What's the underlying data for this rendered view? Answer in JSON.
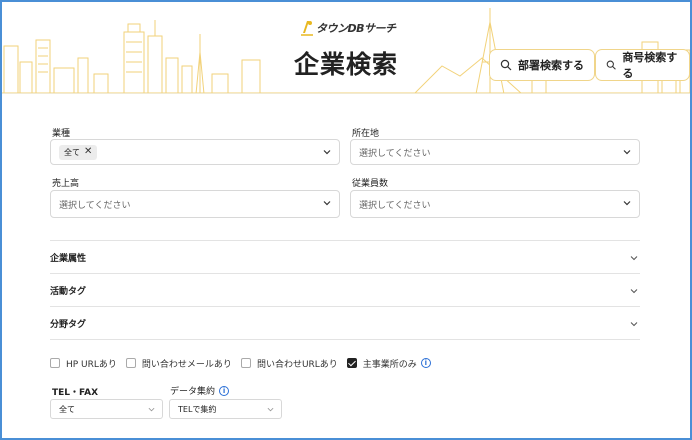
{
  "header": {
    "logo_text": "タウンDBサーチ",
    "title": "企業検索",
    "buttons": [
      {
        "label": "部署検索する",
        "icon": "search-icon"
      },
      {
        "label": "商号検索する",
        "icon": "search-icon"
      }
    ]
  },
  "form": {
    "industry": {
      "label": "業種",
      "tag": "全て",
      "tag_remove": "✕"
    },
    "location": {
      "label": "所在地",
      "placeholder": "選択してください"
    },
    "sales": {
      "label": "売上高",
      "placeholder": "選択してください"
    },
    "employees": {
      "label": "従業員数",
      "placeholder": "選択してください"
    }
  },
  "accordions": [
    {
      "label": "企業属性"
    },
    {
      "label": "活動タグ"
    },
    {
      "label": "分野タグ"
    }
  ],
  "checkboxes": [
    {
      "label": "HP URLあり",
      "checked": false
    },
    {
      "label": "問い合わせメールあり",
      "checked": false
    },
    {
      "label": "問い合わせURLあり",
      "checked": false
    },
    {
      "label": "主事業所のみ",
      "checked": true
    }
  ],
  "filters": {
    "tel_fax": {
      "label": "TEL・FAX",
      "value": "全て"
    },
    "data_agg": {
      "label": "データ集約",
      "value": "TELで集約"
    },
    "info_glyph": "i"
  },
  "colors": {
    "accent_gold": "#f0d58a",
    "skyline": "#f2d27a",
    "frame_border": "#4a8fd6",
    "info_blue": "#2a6fd6"
  }
}
